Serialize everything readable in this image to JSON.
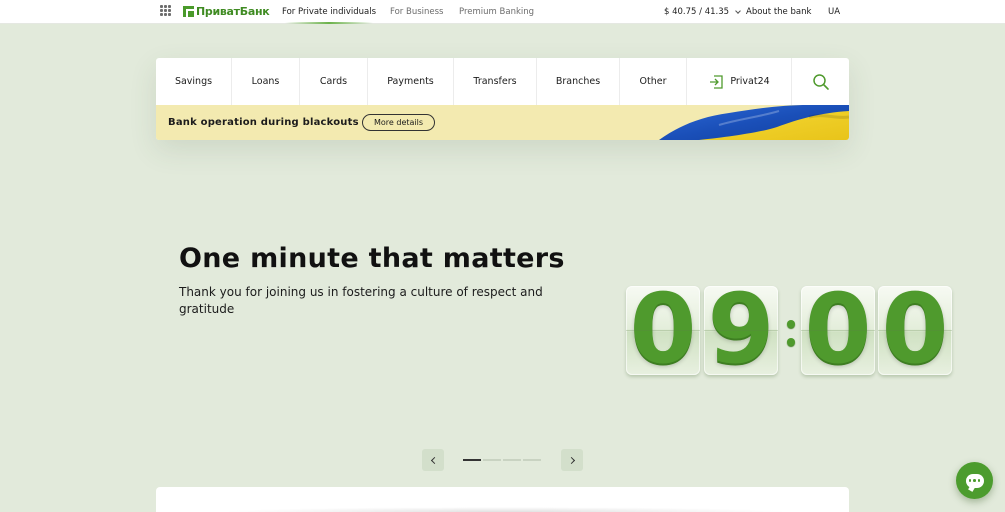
{
  "header": {
    "apps_icon": "grid-icon",
    "logo_text": "ПриватБанк",
    "nav": [
      {
        "label": "For Private individuals",
        "active": true
      },
      {
        "label": "For Business",
        "active": false
      },
      {
        "label": "Premium Banking",
        "active": false
      }
    ],
    "exchange_rate": "$ 40.75 / 41.35",
    "about": "About the bank",
    "language": "UA"
  },
  "menu": {
    "items": [
      "Savings",
      "Loans",
      "Cards",
      "Payments",
      "Transfers",
      "Branches",
      "Other"
    ],
    "privat24": "Privat24",
    "privat24_icon": "login-icon",
    "search_icon": "search-icon"
  },
  "banner": {
    "text": "Bank operation during blackouts",
    "button": "More details",
    "flag_colors": [
      "#1f56c2",
      "#f4d21f"
    ]
  },
  "hero": {
    "title": "One minute that matters",
    "subtitle": "Thank you for joining us in fostering a culture of respect and gratitude",
    "clock": {
      "h1": "0",
      "h2": "9",
      "m1": "0",
      "m2": "0"
    }
  },
  "carousel": {
    "slides": 4,
    "active_slide": 1
  },
  "colors": {
    "brand_green": "#4f9a2d",
    "page_bg": "#e2eadb",
    "banner_bg": "#f3eab0"
  }
}
